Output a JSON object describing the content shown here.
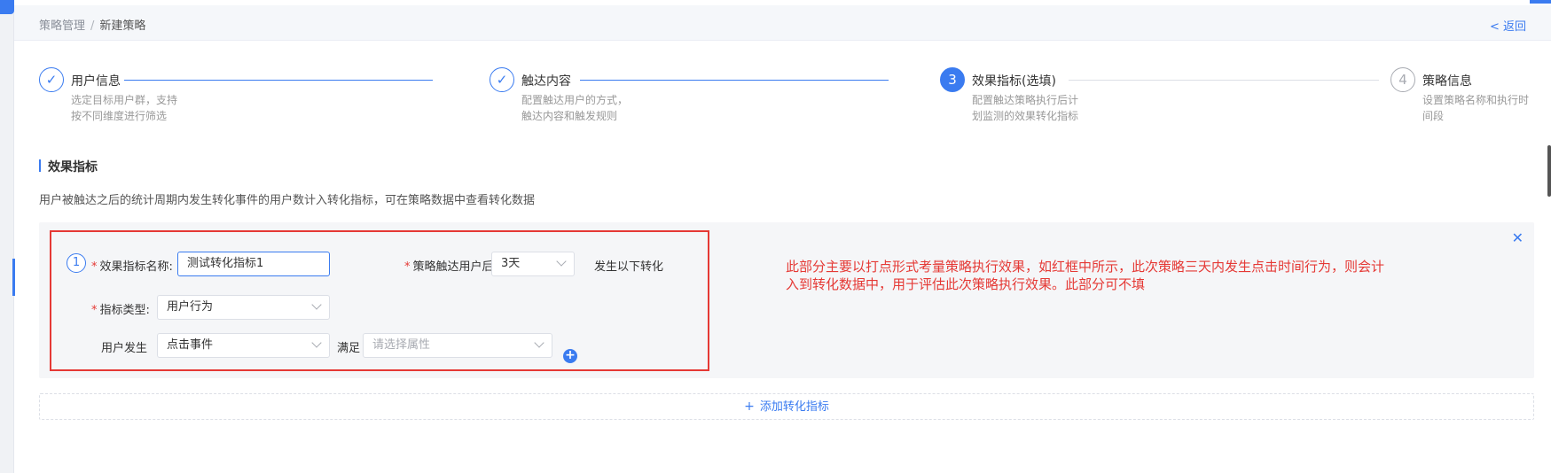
{
  "breadcrumb": {
    "parent": "策略管理",
    "separator": "/",
    "current": "新建策略"
  },
  "back_label": "< 返回",
  "steps": [
    {
      "index": "✓",
      "title": "用户信息",
      "desc": "选定目标用户群，支持按不同维度进行筛选",
      "status": "done"
    },
    {
      "index": "✓",
      "title": "触达内容",
      "desc": "配置触达用户的方式，触达内容和触发规则",
      "status": "done"
    },
    {
      "index": "3",
      "title": "效果指标(选填)",
      "desc": "配置触达策略执行后计划监测的效果转化指标",
      "status": "active"
    },
    {
      "index": "4",
      "title": "策略信息",
      "desc": "设置策略名称和执行时间段",
      "status": "pending"
    }
  ],
  "section": {
    "title": "效果指标",
    "desc": "用户被触达之后的统计周期内发生转化事件的用户数计入转化指标，可在策略数据中查看转化数据"
  },
  "metric": {
    "number": "1",
    "name_label": "效果指标名称:",
    "name_value": "测试转化指标1",
    "after_label": "策略触达用户后",
    "after_value": "3天",
    "after_suffix": "发生以下转化",
    "type_label": "指标类型:",
    "type_value": "用户行为",
    "user_label": "用户发生",
    "event_value": "点击事件",
    "satisfy_label": "满足",
    "attr_placeholder": "请选择属性",
    "close_icon": "close-icon",
    "add_icon": "plus-circle-icon"
  },
  "annotation": "此部分主要以打点形式考量策略执行效果，如红框中所示，此次策略三天内发生点击时间行为，则会计入到转化数据中，用于评估此次策略执行效果。此部分可不填",
  "add_metric_label": "添加转化指标",
  "colors": {
    "accent": "#3a7bf0",
    "annotation": "#e53935",
    "card_bg": "#f5f6f8"
  }
}
